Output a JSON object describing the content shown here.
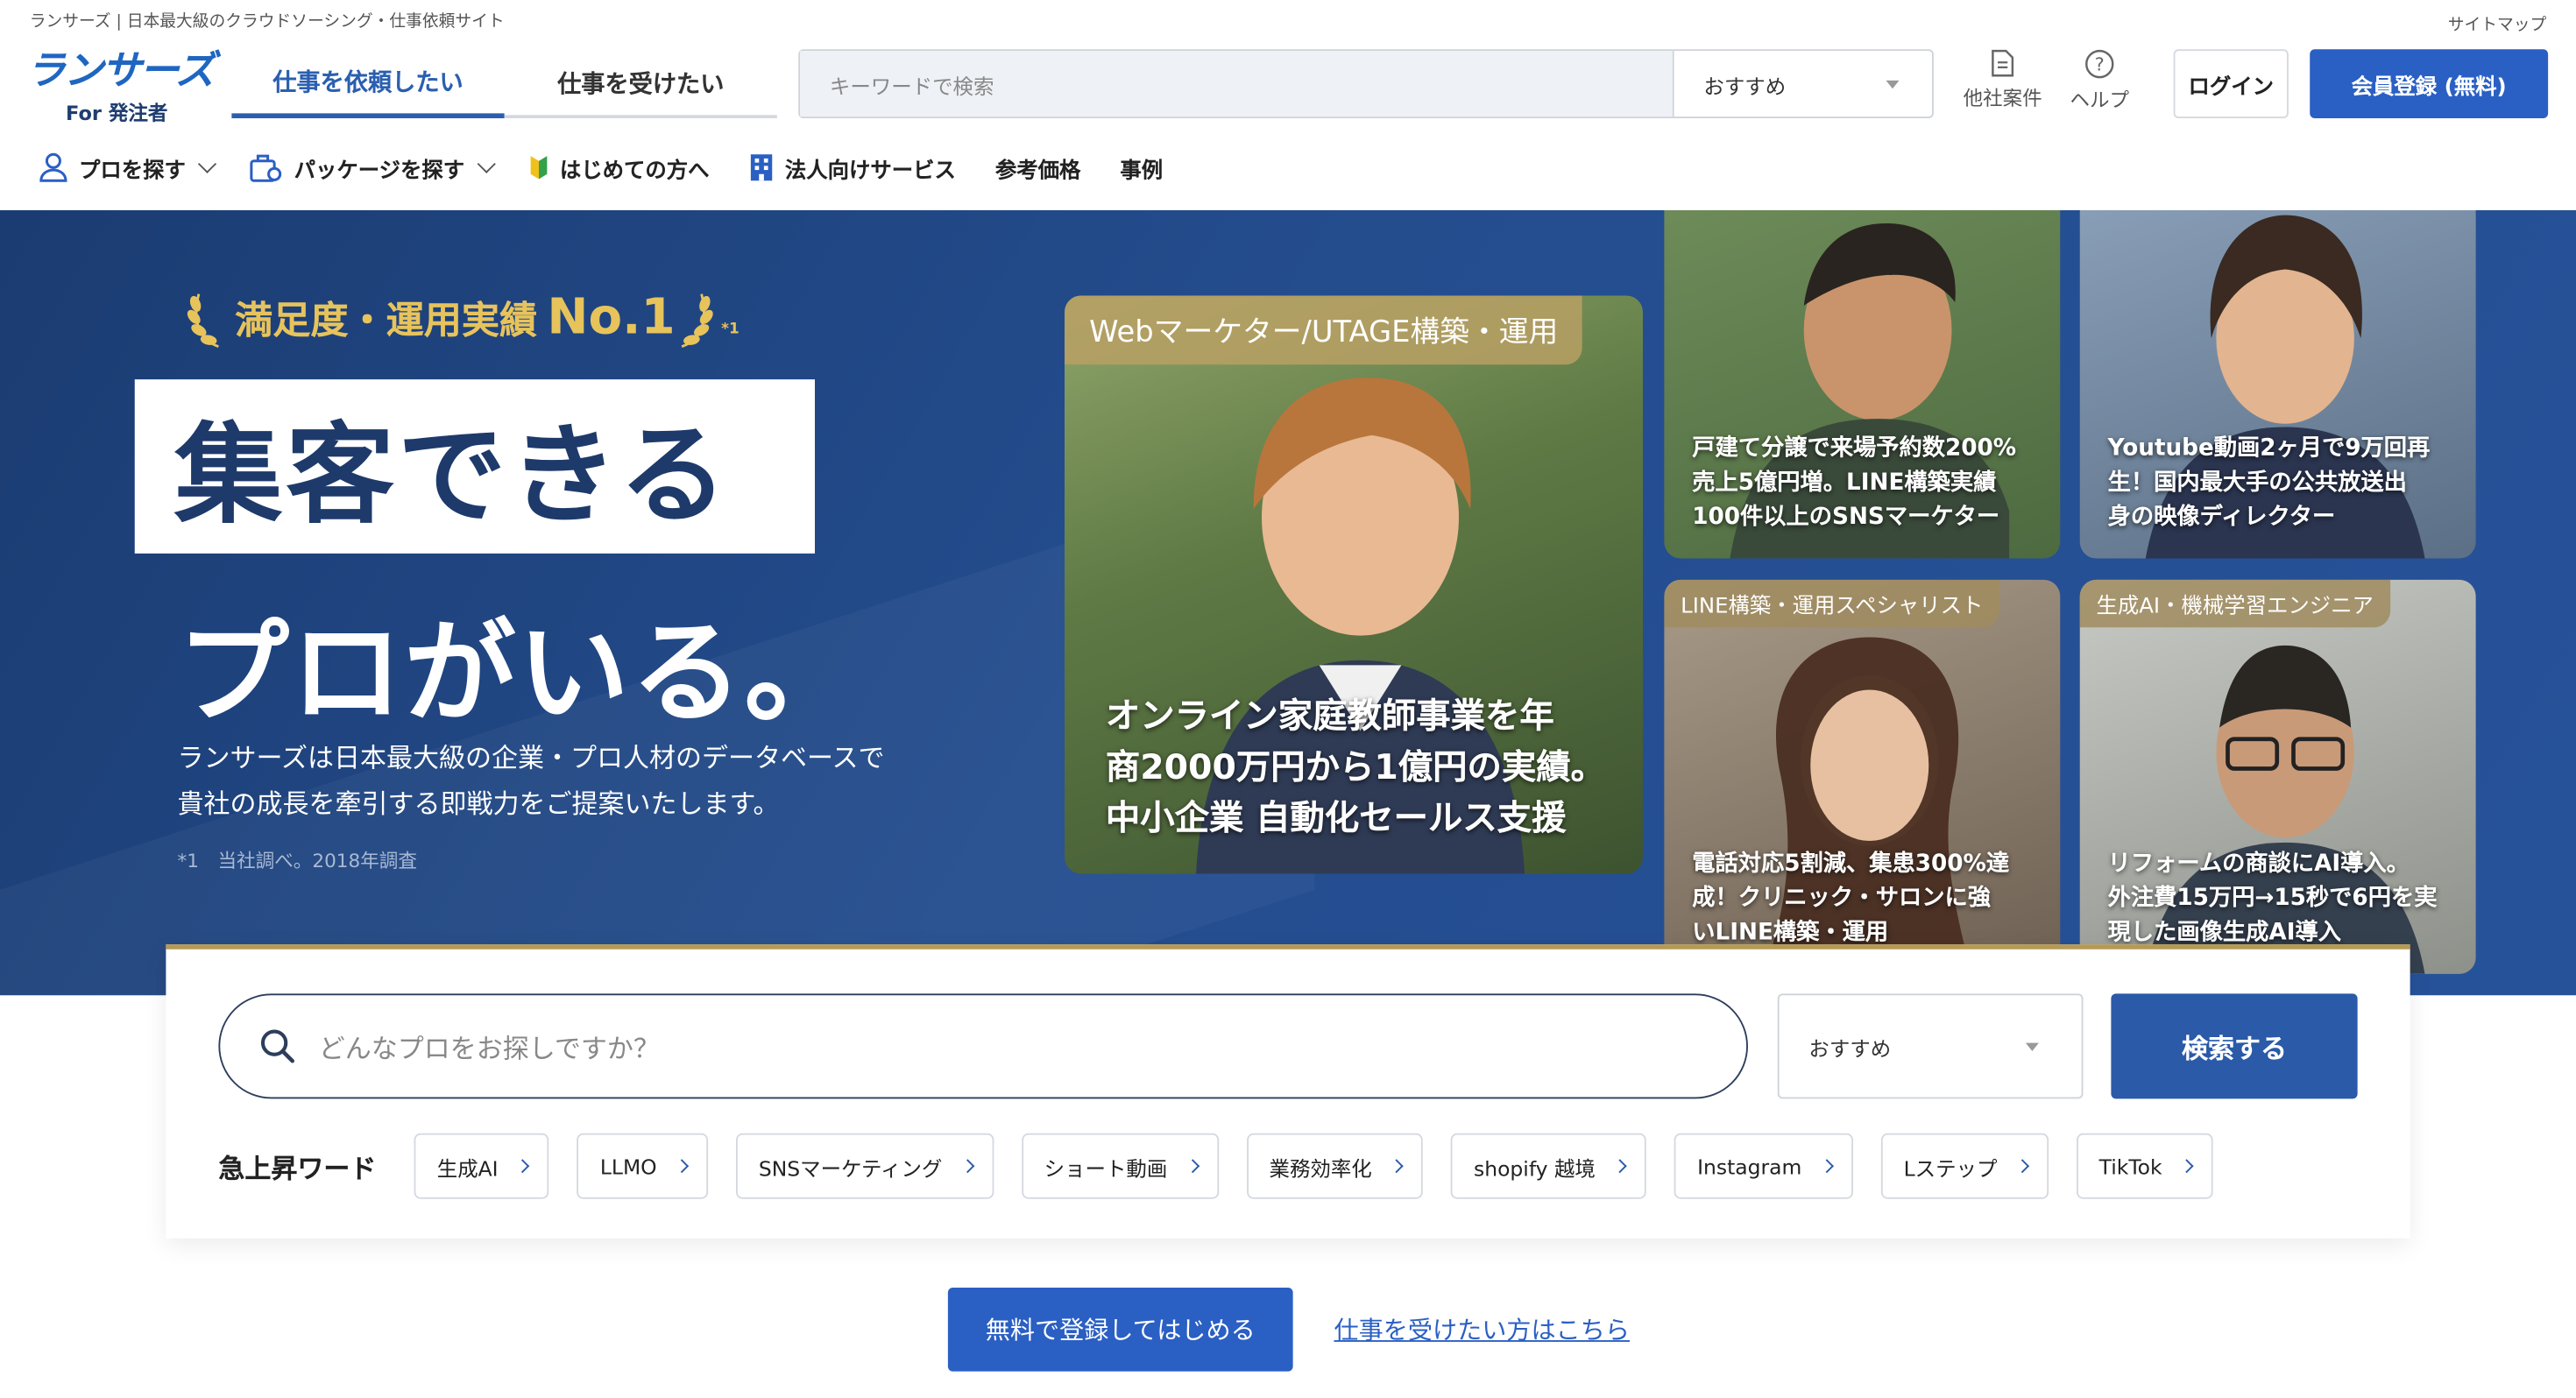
{
  "header": {
    "tagline": "ランサーズ | 日本最大級のクラウドソーシング・仕事依頼サイト",
    "sitemap": "サイトマップ",
    "logo_main": "ランサーズ",
    "logo_sub": "For 発注者",
    "tab_client": "仕事を依頼したい",
    "tab_worker": "仕事を受けたい",
    "search_placeholder": "キーワードで検索",
    "search_select": "おすすめ",
    "other_jobs": "他社案件",
    "help": "ヘルプ",
    "login": "ログイン",
    "register": "会員登録 (無料)"
  },
  "subnav": {
    "find_pro": "プロを探す",
    "find_package": "パッケージを探す",
    "beginners": "はじめての方へ",
    "corporate": "法人向けサービス",
    "pricing": "参考価格",
    "cases": "事例"
  },
  "hero": {
    "award_text": "満足度・運用実績",
    "award_no": "No.1",
    "award_note": "*1",
    "headline_1": "集客できる",
    "headline_2": "プロがいる。",
    "desc_1": "ランサーズは日本最大級の企業・プロ人材のデータベースで",
    "desc_2": "貴社の成長を牽引する即戦力をご提案いたします。",
    "note": "*1　当社調べ。2018年調査"
  },
  "cards": {
    "big": {
      "tag": "Webマーケター/UTAGE構築・運用",
      "caption": [
        "オンライン家庭教師事業を年",
        "商2000万円から1億円の実績。",
        "中小企業 自動化セールス支援"
      ]
    },
    "c1": {
      "caption": [
        "戸建て分譲で来場予約数200%",
        "売上5億円増。LINE構築実績",
        "100件以上のSNSマーケター"
      ]
    },
    "c2": {
      "caption": [
        "Youtube動画2ヶ月で9万回再",
        "生！国内最大手の公共放送出",
        "身の映像ディレクター"
      ]
    },
    "c3": {
      "tag": "LINE構築・運用スペシャリスト",
      "caption": [
        "電話対応5割減、集患300%達",
        "成！クリニック・サロンに強",
        "いLINE構築・運用"
      ]
    },
    "c4": {
      "tag": "生成AI・機械学習エンジニア",
      "caption": [
        "リフォームの商談にAI導入。",
        "外注費15万円→15秒で6円を実",
        "現した画像生成AI導入"
      ]
    }
  },
  "search_panel": {
    "placeholder": "どんなプロをお探しですか？",
    "select": "おすすめ",
    "button": "検索する",
    "trend_label": "急上昇ワード",
    "chips": [
      "生成AI",
      "LLMO",
      "SNSマーケティング",
      "ショート動画",
      "業務効率化",
      "shopify 越境",
      "Instagram",
      "Lステップ",
      "TikTok"
    ]
  },
  "cta": {
    "register": "無料で登録してはじめる",
    "worker_link": "仕事を受けたい方はこちら"
  },
  "colors": {
    "brand_blue": "#2a5fc4",
    "hero_navy": "#1b3c72",
    "gold": "#e7c35c"
  }
}
